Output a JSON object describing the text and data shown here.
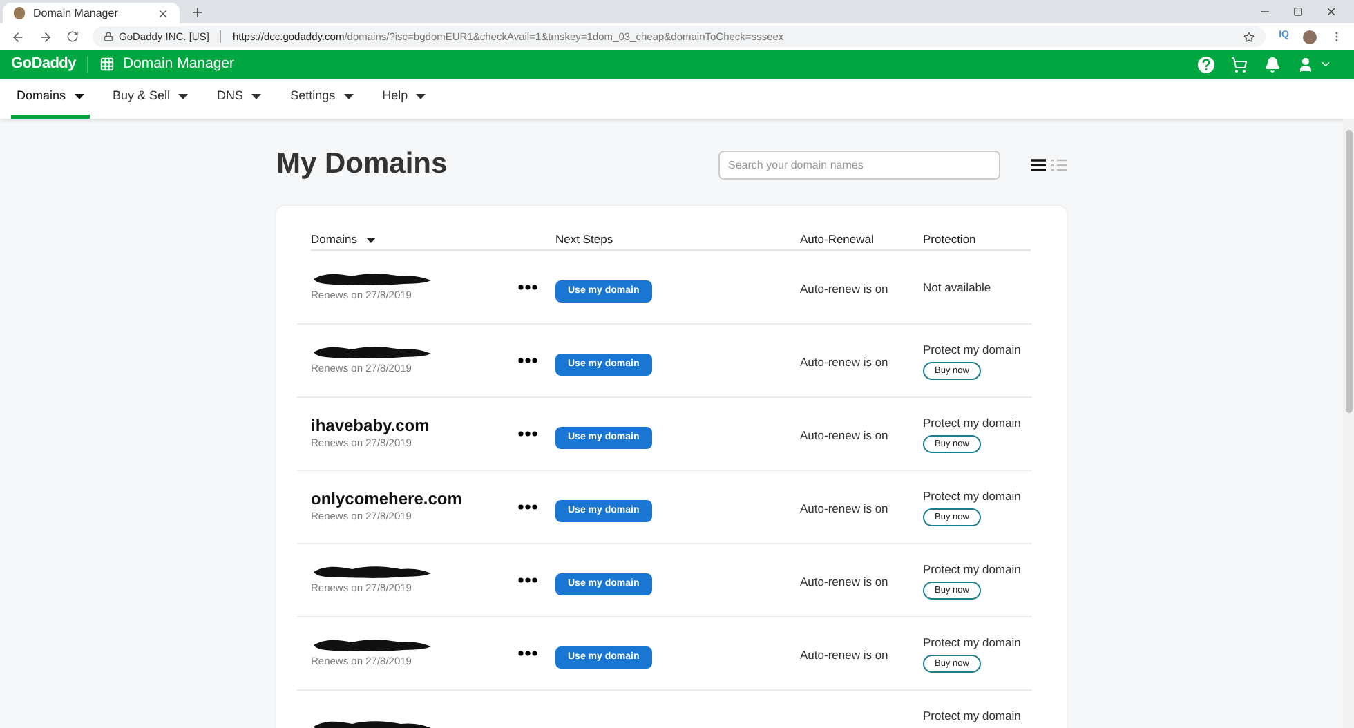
{
  "browser": {
    "tab_title": "Domain Manager",
    "site_label": "GoDaddy INC. [US]",
    "url_host": "https://dcc.godaddy.com",
    "url_path": "/domains/?isc=bgdomEUR1&checkAvail=1&tmskey=1dom_03_cheap&domainToCheck=ssseex",
    "extension_label": "IQ"
  },
  "header": {
    "logo": "GoDaddy",
    "app_title": "Domain Manager"
  },
  "nav": [
    {
      "label": "Domains",
      "selected": true
    },
    {
      "label": "Buy & Sell",
      "selected": false
    },
    {
      "label": "DNS",
      "selected": false
    },
    {
      "label": "Settings",
      "selected": false
    },
    {
      "label": "Help",
      "selected": false
    }
  ],
  "page_title": "My Domains",
  "search": {
    "placeholder": "Search your domain names"
  },
  "view_toggle": [
    {
      "kind": "list",
      "selected": true
    },
    {
      "kind": "compact",
      "selected": false
    }
  ],
  "table": {
    "columns": [
      "Domains",
      "Next Steps",
      "Auto-Renewal",
      "Protection"
    ],
    "rows": [
      {
        "kind": "redacted",
        "renews": "Renews on 27/8/2019",
        "button_label": "Use my domain",
        "auto_renew": "Auto-renew is on",
        "protection": "Not available"
      },
      {
        "kind": "redacted",
        "renews": "Renews on 27/8/2019",
        "button_label": "Use my domain",
        "auto_renew": "Auto-renew is on",
        "protection": "Protect my domain",
        "protection_button": "Buy now"
      },
      {
        "kind": "named",
        "domain": "ihavebaby.com",
        "renews": "Renews on 27/8/2019",
        "button_label": "Use my domain",
        "auto_renew": "Auto-renew is on",
        "protection": "Protect my domain",
        "protection_button": "Buy now"
      },
      {
        "kind": "named",
        "domain": "onlycomehere.com",
        "renews": "Renews on 27/8/2019",
        "button_label": "Use my domain",
        "auto_renew": "Auto-renew is on",
        "protection": "Protect my domain",
        "protection_button": "Buy now"
      },
      {
        "kind": "redacted",
        "renews": "Renews on 27/8/2019",
        "button_label": "Use my domain",
        "auto_renew": "Auto-renew is on",
        "protection": "Protect my domain",
        "protection_button": "Buy now"
      },
      {
        "kind": "redacted",
        "renews": "Renews on 27/8/2019",
        "button_label": "Use my domain",
        "auto_renew": "Auto-renew is on",
        "protection": "Protect my domain",
        "protection_button": "Buy now"
      },
      {
        "kind": "redacted",
        "protection": "Protect my domain"
      }
    ]
  }
}
